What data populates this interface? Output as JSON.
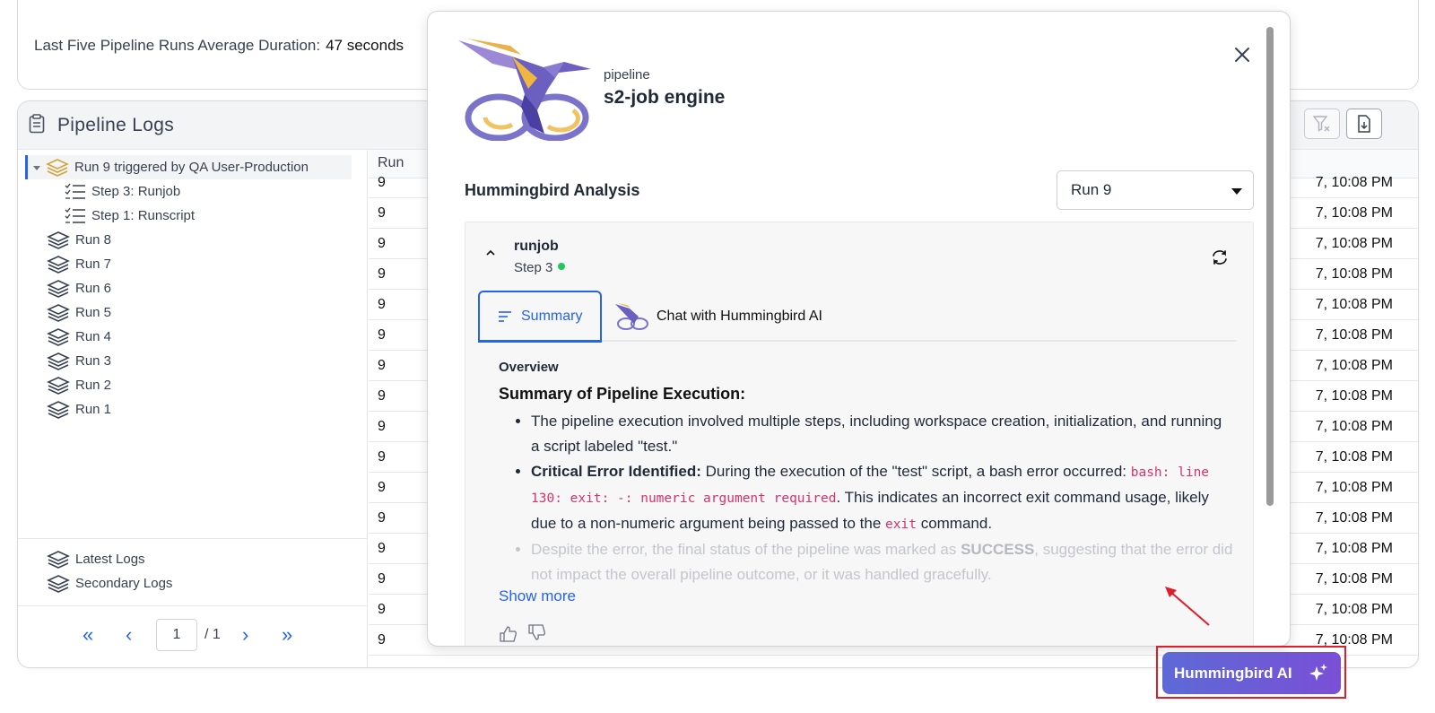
{
  "summary_card": {
    "avg_label": "Last Five Pipeline Runs Average Duration:",
    "avg_value": "47 seconds"
  },
  "logs": {
    "title": "Pipeline Logs",
    "tree": [
      {
        "label": "Run 9 triggered by QA User-Production",
        "selected": true,
        "expanded": true
      },
      {
        "label": "Step 3: Runjob",
        "child": true
      },
      {
        "label": "Step 1: Runscript",
        "child": true
      },
      {
        "label": "Run 8"
      },
      {
        "label": "Run 7"
      },
      {
        "label": "Run 6"
      },
      {
        "label": "Run 5"
      },
      {
        "label": "Run 4"
      },
      {
        "label": "Run 3"
      },
      {
        "label": "Run 2"
      },
      {
        "label": "Run 1"
      }
    ],
    "bottom_links": [
      "Latest Logs",
      "Secondary Logs"
    ],
    "pager": {
      "page": "1",
      "total": "/ 1"
    },
    "grid": {
      "header_run": "Run",
      "rows": [
        {
          "run": "9",
          "time": "7, 10:08 PM"
        },
        {
          "run": "9",
          "time": "7, 10:08 PM"
        },
        {
          "run": "9",
          "time": "7, 10:08 PM"
        },
        {
          "run": "9",
          "time": "7, 10:08 PM"
        },
        {
          "run": "9",
          "time": "7, 10:08 PM"
        },
        {
          "run": "9",
          "time": "7, 10:08 PM"
        },
        {
          "run": "9",
          "time": "7, 10:08 PM"
        },
        {
          "run": "9",
          "time": "7, 10:08 PM"
        },
        {
          "run": "9",
          "time": "7, 10:08 PM"
        },
        {
          "run": "9",
          "time": "7, 10:08 PM"
        },
        {
          "run": "9",
          "time": "7, 10:08 PM"
        },
        {
          "run": "9",
          "time": "7, 10:08 PM"
        },
        {
          "run": "9",
          "time": "7, 10:08 PM"
        },
        {
          "run": "9",
          "time": "7, 10:08 PM"
        },
        {
          "run": "9",
          "time": "7, 10:08 PM"
        },
        {
          "run": "9",
          "time": "7, 10:08 PM"
        }
      ]
    }
  },
  "modal": {
    "kind": "pipeline",
    "engine": "s2-job engine",
    "analysis_title": "Hummingbird Analysis",
    "run_select": "Run 9",
    "job": {
      "name": "runjob",
      "step": "Step 3"
    },
    "tabs": {
      "summary": "Summary",
      "chat": "Chat with Hummingbird AI"
    },
    "overview_label": "Overview",
    "summary_heading": "Summary of Pipeline Execution:",
    "bullet1": "The pipeline execution involved multiple steps, including workspace creation, initialization, and running a script labeled \"test.\"",
    "bullet2": {
      "lead": "Critical Error Identified:",
      "text1": " During the execution of the \"test\" script, a bash error occurred: ",
      "code1": "bash: line 130: exit: -: numeric argument required",
      "text2": ". This indicates an incorrect exit command usage, likely due to a non-numeric argument being passed to the ",
      "code2": "exit",
      "text3": " command."
    },
    "bullet3": {
      "text1": "Despite the error, the final status of the pipeline was marked as ",
      "strong": "SUCCESS",
      "text2": ", suggesting that the error did not impact the overall pipeline outcome, or it was handled gracefully."
    },
    "show_more": "Show more"
  },
  "ai_button": {
    "label": "Hummingbird AI"
  },
  "colors": {
    "accent": "#2563eb",
    "ai_gradient_start": "#5d6ad6",
    "ai_gradient_end": "#7a4fd6",
    "highlight": "#e11d2a",
    "success_dot": "#22c55e"
  }
}
